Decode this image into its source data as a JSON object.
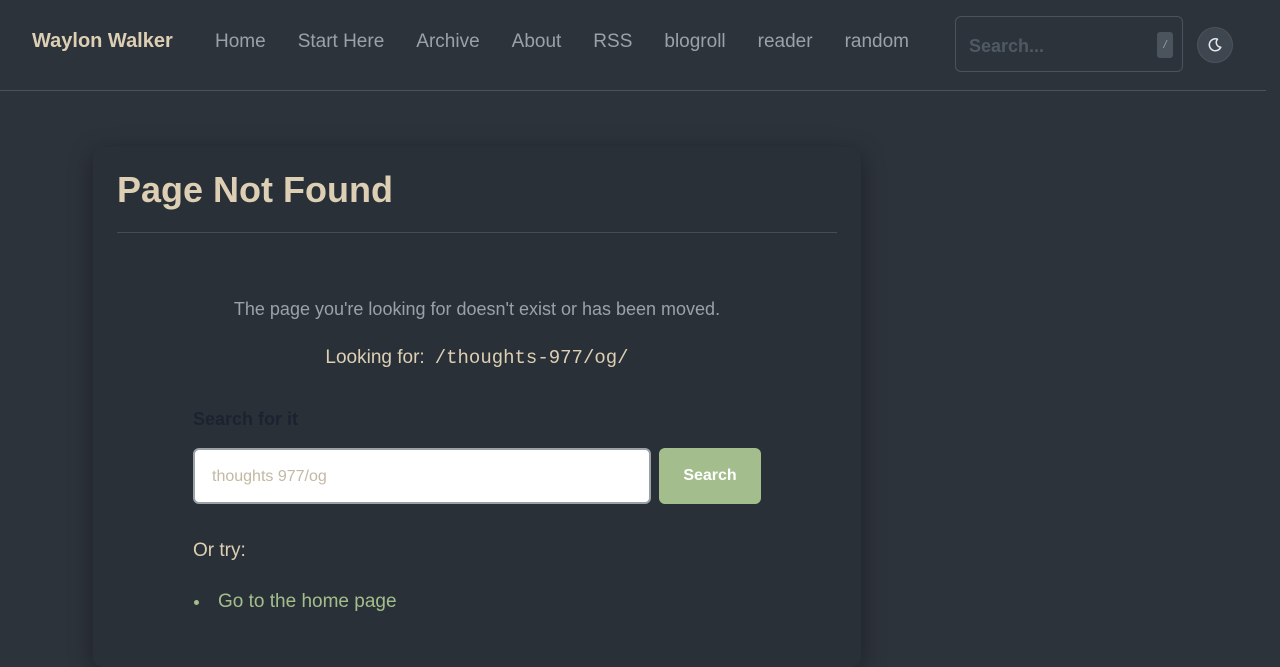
{
  "header": {
    "brand": "Waylon Walker",
    "nav": [
      "Home",
      "Start Here",
      "Archive",
      "About",
      "RSS",
      "blogroll",
      "reader",
      "random"
    ],
    "search_placeholder": "Search...",
    "search_shortcut": "/",
    "theme_toggle_icon": "moon-icon"
  },
  "main": {
    "title": "Page Not Found",
    "message": "The page you're looking for doesn't exist or has been moved.",
    "looking_for_label": "Looking for:",
    "looking_for_path": "/thoughts-977/og/",
    "search_label": "Search for it",
    "search_placeholder": "thoughts 977/og",
    "search_button": "Search",
    "or_try": "Or try:",
    "links": [
      "Go to the home page"
    ]
  },
  "colors": {
    "background": "#2d333b",
    "accent": "#a3be8c",
    "heading": "#dccfb4",
    "muted": "#9aa1a8"
  }
}
